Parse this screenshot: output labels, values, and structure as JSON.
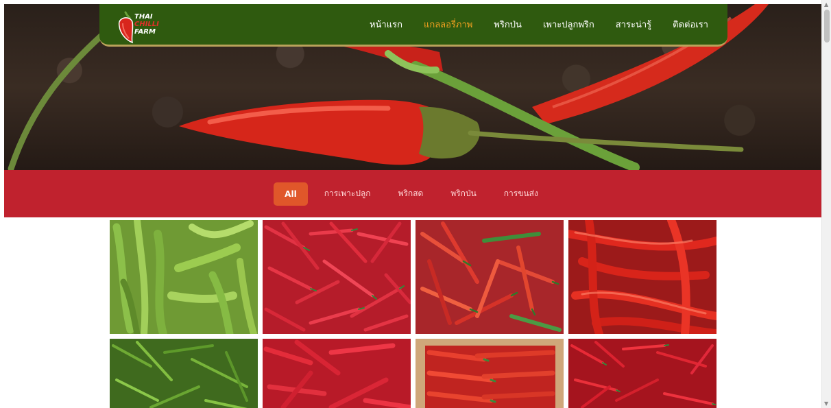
{
  "logo": {
    "line1": "THAI",
    "line2": "CHILLI",
    "line3": "FARM"
  },
  "nav": {
    "items": [
      {
        "label": "หน้าแรก",
        "active": false
      },
      {
        "label": "แกลลอรี่ภาพ",
        "active": true
      },
      {
        "label": "พริกป่น",
        "active": false
      },
      {
        "label": "เพาะปลูกพริก",
        "active": false
      },
      {
        "label": "สาระน่ารู้",
        "active": false
      },
      {
        "label": "ติดต่อเรา",
        "active": false
      }
    ],
    "active_color": "#f0a020",
    "bg_color": "#2f5a0f"
  },
  "filters": {
    "items": [
      {
        "label": "All",
        "active": true
      },
      {
        "label": "การเพาะปลูก",
        "active": false
      },
      {
        "label": "พริกสด",
        "active": false
      },
      {
        "label": "พริกป่น",
        "active": false
      },
      {
        "label": "การขนส่ง",
        "active": false
      }
    ],
    "bar_color": "#c0222e",
    "active_color": "#e0572a"
  },
  "gallery": {
    "tiles": [
      {
        "name": "green-chillies",
        "icon": "green-chilli-photo"
      },
      {
        "name": "red-thai-chillies",
        "icon": "red-chilli-photo"
      },
      {
        "name": "mixed-chillies",
        "icon": "mixed-chilli-photo"
      },
      {
        "name": "large-red-chillies",
        "icon": "red-chilli-photo"
      },
      {
        "name": "green-chilli-pile",
        "icon": "green-chilli-photo"
      },
      {
        "name": "red-chilli-pile",
        "icon": "red-chilli-photo"
      },
      {
        "name": "chilli-crate",
        "icon": "crate-photo"
      },
      {
        "name": "small-red-chillies",
        "icon": "red-chilli-photo"
      }
    ]
  }
}
